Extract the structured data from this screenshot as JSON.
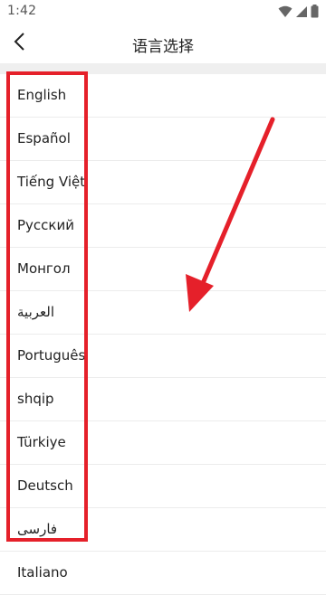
{
  "status_bar": {
    "time": "1:42",
    "icons": [
      "wifi-icon",
      "signal-icon",
      "battery-icon"
    ]
  },
  "header": {
    "back_icon": "chevron-left-icon",
    "title": "语言选择"
  },
  "languages": [
    {
      "label": "English"
    },
    {
      "label": "Español"
    },
    {
      "label": "Tiếng Việt"
    },
    {
      "label": "Русский"
    },
    {
      "label": "Монгол"
    },
    {
      "label": "العربية"
    },
    {
      "label": "Português"
    },
    {
      "label": "shqip"
    },
    {
      "label": "Türkiye"
    },
    {
      "label": "Deutsch"
    },
    {
      "label": "فارسی"
    },
    {
      "label": "Italiano"
    }
  ],
  "annotation": {
    "color": "#e5202a"
  }
}
